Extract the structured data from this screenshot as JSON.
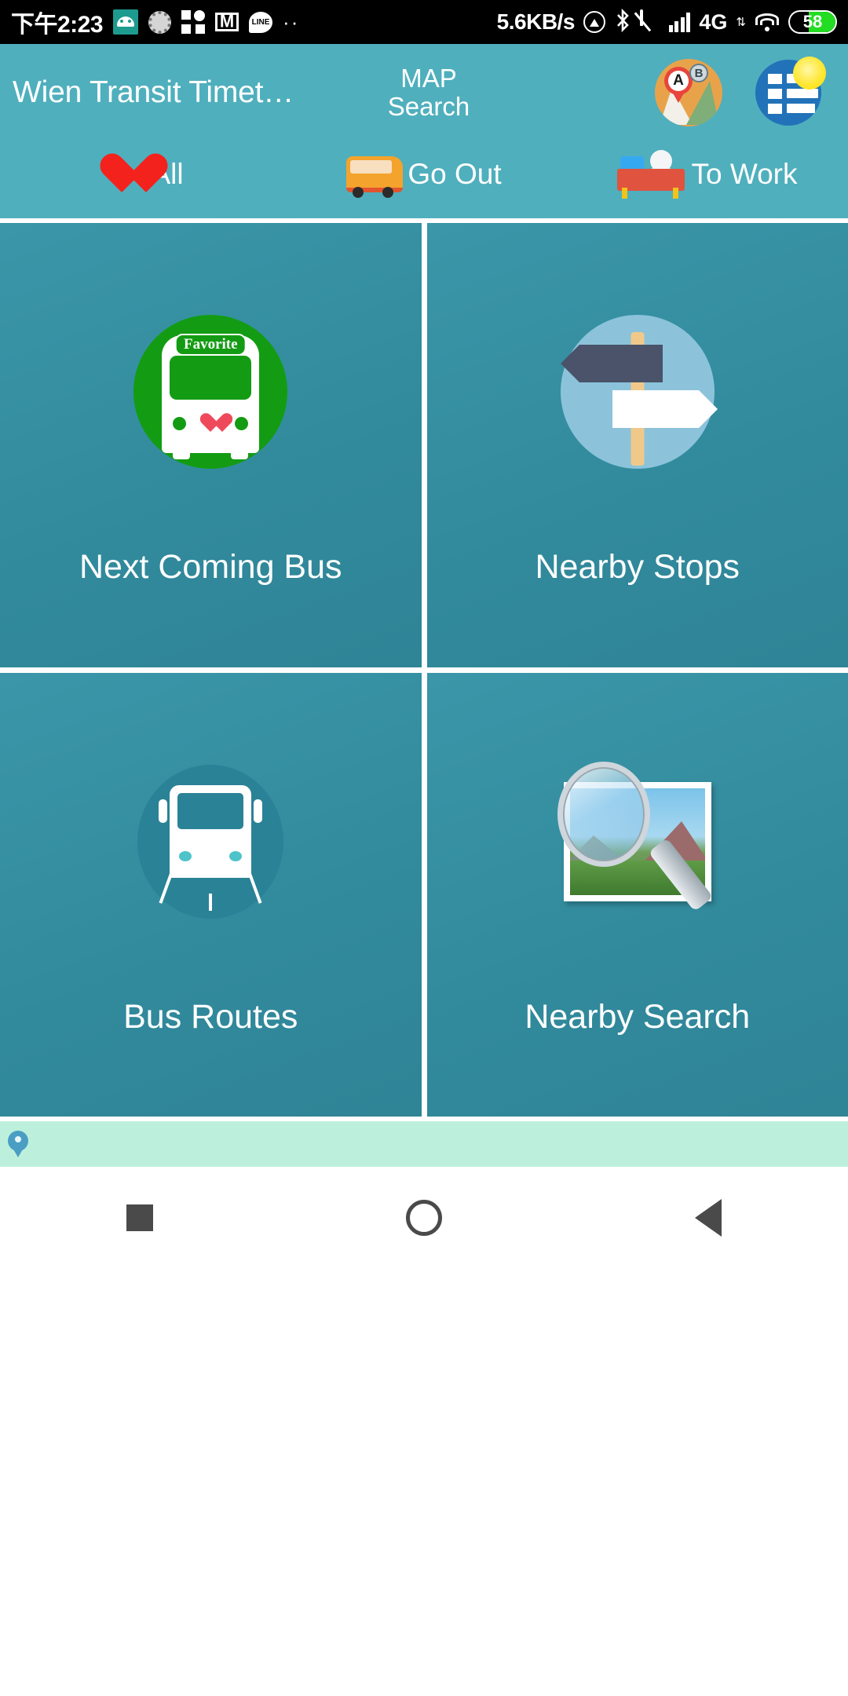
{
  "status_bar": {
    "time": "下午2:23",
    "network_speed": "5.6KB/s",
    "network_type": "4G",
    "battery_percent": "58",
    "icons": [
      "android-icon",
      "sun-loading-icon",
      "apps-icon",
      "gmail-icon",
      "line-icon",
      "more-dots-icon",
      "cast-icon",
      "bluetooth-icon",
      "mute-bell-icon",
      "signal-bars-icon",
      "data-transfer-icon",
      "wifi-icon",
      "battery-icon"
    ],
    "bluetooth_glyph": "✚"
  },
  "header": {
    "title": "Wien Transit Timet…",
    "map_search_line1": "MAP",
    "map_search_line2": "Search",
    "map_route_icon": "map-route-icon",
    "map_pin_a": "A",
    "map_pin_b": "B",
    "list_icon": "timetable-list-icon"
  },
  "tabs": [
    {
      "label": "All",
      "icon": "heart-icon"
    },
    {
      "label": "Go Out",
      "icon": "bus-icon"
    },
    {
      "label": "To Work",
      "icon": "office-desk-icon"
    }
  ],
  "grid": [
    {
      "label": "Next Coming Bus",
      "icon": "favorite-bus-icon",
      "sign_text": "Favorite"
    },
    {
      "label": "Nearby Stops",
      "icon": "signpost-icon"
    },
    {
      "label": "Bus Routes",
      "icon": "bus-route-icon"
    },
    {
      "label": "Nearby Search",
      "icon": "photo-magnifier-icon"
    }
  ],
  "banner": {
    "icon": "location-pin-icon",
    "text": ""
  },
  "navigation_bar": {
    "recents": "recents-square-icon",
    "home": "home-circle-icon",
    "back": "back-triangle-icon"
  },
  "colors": {
    "header_bg": "#4fafbd",
    "tile_bg": "#318a9c",
    "favorite_green": "#139c13",
    "signpost_blue": "#8cc3db",
    "banner_bg": "#bdf0dc",
    "heart_red": "#f4221c"
  }
}
